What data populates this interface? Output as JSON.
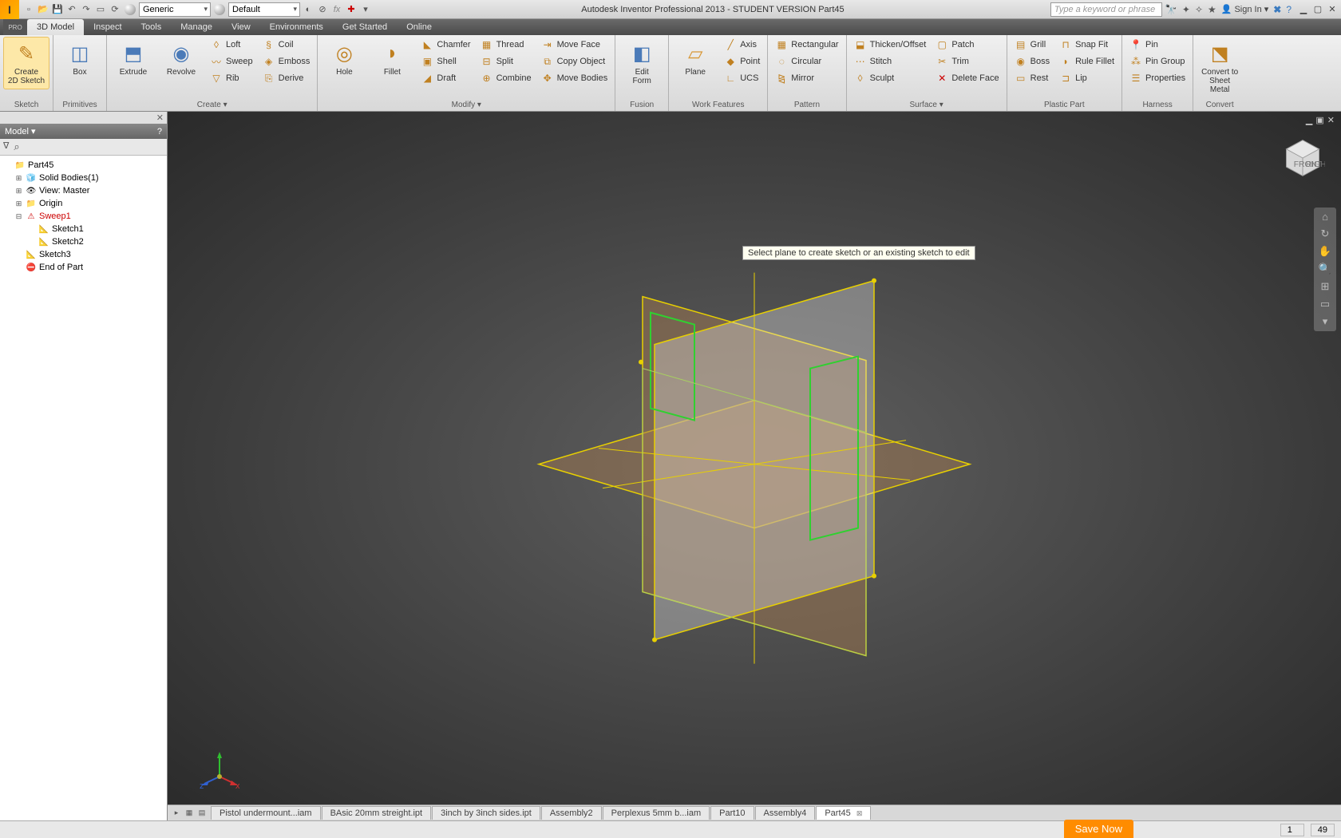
{
  "title": "Autodesk Inventor Professional 2013 - STUDENT VERSION  Part45",
  "qat_combo1": "Generic",
  "qat_combo2": "Default",
  "search_placeholder": "Type a keyword or phrase",
  "signin": "Sign In",
  "tabs": [
    "3D Model",
    "Inspect",
    "Tools",
    "Manage",
    "View",
    "Environments",
    "Get Started",
    "Online"
  ],
  "active_tab": 0,
  "ribbon": {
    "sketch": {
      "label": "Sketch",
      "big": "Create\n2D Sketch"
    },
    "primitives": {
      "label": "Primitives",
      "big": "Box"
    },
    "create": {
      "label": "Create ▾",
      "big1": "Extrude",
      "big2": "Revolve",
      "col1": [
        "Loft",
        "Sweep",
        "Rib"
      ],
      "col2": [
        "Coil",
        "Emboss",
        "Derive"
      ]
    },
    "modify": {
      "label": "Modify ▾",
      "big1": "Hole",
      "big2": "Fillet",
      "col1": [
        "Chamfer",
        "Shell",
        "Draft"
      ],
      "col2": [
        "Thread",
        "Split",
        "Combine"
      ],
      "col3": [
        "Move Face",
        "Copy Object",
        "Move Bodies"
      ]
    },
    "fusion": {
      "label": "Fusion",
      "big": "Edit\nForm"
    },
    "work": {
      "label": "Work Features",
      "big": "Plane",
      "col": [
        "Axis",
        "Point",
        "UCS"
      ]
    },
    "pattern": {
      "label": "Pattern",
      "col": [
        "Rectangular",
        "Circular",
        "Mirror"
      ]
    },
    "surface": {
      "label": "Surface ▾",
      "col1": [
        "Thicken/Offset",
        "Stitch",
        "Sculpt"
      ],
      "col2": [
        "Patch",
        "Trim",
        "Delete Face"
      ]
    },
    "plastic": {
      "label": "Plastic Part",
      "col1": [
        "Grill",
        "Boss",
        "Rest"
      ],
      "col2": [
        "Snap Fit",
        "Rule Fillet",
        "Lip"
      ]
    },
    "harness": {
      "label": "Harness",
      "col": [
        "Pin",
        "Pin Group",
        "Properties"
      ]
    },
    "convert": {
      "label": "Convert",
      "big": "Convert to\nSheet Metal"
    }
  },
  "browser": {
    "title": "Model ▾",
    "items": [
      {
        "l": 0,
        "exp": "",
        "icon": "📁",
        "txt": "Part45",
        "cls": ""
      },
      {
        "l": 1,
        "exp": "⊞",
        "icon": "🧊",
        "txt": "Solid Bodies(1)",
        "cls": ""
      },
      {
        "l": 1,
        "exp": "⊞",
        "icon": "👁",
        "txt": "View: Master",
        "cls": ""
      },
      {
        "l": 1,
        "exp": "⊞",
        "icon": "📁",
        "txt": "Origin",
        "cls": ""
      },
      {
        "l": 1,
        "exp": "⊟",
        "icon": "⚠",
        "txt": "Sweep1",
        "cls": "err"
      },
      {
        "l": 2,
        "exp": "",
        "icon": "📐",
        "txt": "Sketch1",
        "cls": ""
      },
      {
        "l": 2,
        "exp": "",
        "icon": "📐",
        "txt": "Sketch2",
        "cls": ""
      },
      {
        "l": 1,
        "exp": "",
        "icon": "📐",
        "txt": "Sketch3",
        "cls": ""
      },
      {
        "l": 1,
        "exp": "",
        "icon": "⛔",
        "txt": "End of Part",
        "cls": ""
      }
    ]
  },
  "tooltip_text": "Select plane to create sketch or an existing sketch to edit",
  "doctabs": [
    "Pistol undermount...iam",
    "BAsic 20mm streight.ipt",
    "3inch by 3inch sides.ipt",
    "Assembly2",
    "Perplexus 5mm b...iam",
    "Part10",
    "Assembly4",
    "Part45"
  ],
  "active_doctab": 7,
  "status": {
    "a": "1",
    "b": "49"
  },
  "savenow": "Save Now"
}
